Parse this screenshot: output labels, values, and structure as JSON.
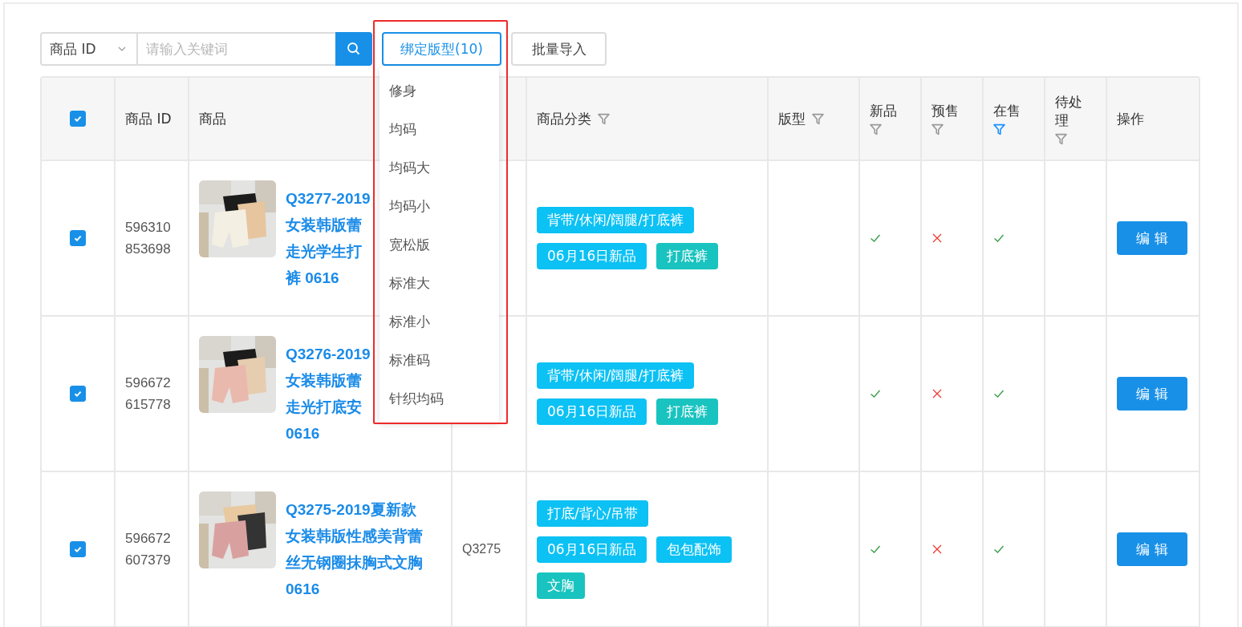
{
  "toolbar": {
    "search_type": "商品 ID",
    "search": {
      "placeholder": "请输入关键词"
    },
    "buttons": [
      {
        "label": "绑定版型(10)",
        "selected": true
      },
      {
        "label": "批量导入",
        "selected": false
      }
    ]
  },
  "dropdown": {
    "items": [
      "修身",
      "均码",
      "均码大",
      "均码小",
      "宽松版",
      "标准大",
      "标准小",
      "标准码",
      "针织均码"
    ]
  },
  "table": {
    "select_all": true,
    "columns": [
      {
        "label": "商品 ID"
      },
      {
        "label": "商品"
      },
      {},
      {
        "label": "商品分类",
        "filter": true,
        "filter_active": false
      },
      {
        "label": "版型",
        "filter": true,
        "filter_active": false
      },
      {
        "label": "新品",
        "filter": true,
        "filter_active": false
      },
      {
        "label": "预售",
        "filter": true,
        "filter_active": false
      },
      {
        "label": "在售",
        "filter": true,
        "filter_active": true
      },
      {
        "label": "待处理",
        "filter": true,
        "filter_active": false
      },
      {
        "label": "操作"
      }
    ],
    "rows": [
      {
        "selected": true,
        "id": "596310853698",
        "picture": {
          "kind": "picture"
        },
        "name_lines": [
          "Q3277-2019",
          "女装韩版蕾",
          "走光学生打",
          "裤 0616"
        ],
        "tags": [
          {
            "label": "背带/休闲/阔腿/打底裤",
            "color": "#0cc1f4"
          },
          {
            "label": "06月16日新品",
            "color": "#0cc1f4"
          },
          {
            "label": "打底裤",
            "color": "#19c3bf"
          }
        ],
        "new": true,
        "presale": false,
        "on_sale": true,
        "action": "编 辑"
      },
      {
        "selected": true,
        "id": "596672615778",
        "picture": {
          "kind": "picture"
        },
        "name_lines": [
          "Q3276-2019",
          "女装韩版蕾",
          "走光打底安",
          "0616"
        ],
        "tags": [
          {
            "label": "背带/休闲/阔腿/打底裤",
            "color": "#0cc1f4"
          },
          {
            "label": "06月16日新品",
            "color": "#0cc1f4"
          },
          {
            "label": "打底裤",
            "color": "#19c3bf"
          }
        ],
        "new": true,
        "presale": false,
        "on_sale": true,
        "action": "编 辑"
      },
      {
        "selected": true,
        "id": "596672607379",
        "picture": {
          "kind": "picture"
        },
        "name_lines": [
          "Q3275-2019夏新款",
          "女装韩版性感美背蕾",
          "丝无钢圈抹胸式文胸",
          "0616"
        ],
        "code": "Q3275",
        "tags": [
          {
            "label": "打底/背心/吊带",
            "color": "#0cc1f4"
          },
          {
            "label": "06月16日新品",
            "color": "#0cc1f4"
          },
          {
            "label": "包包配饰",
            "color": "#0cc1f4"
          },
          {
            "label": "文胸",
            "color": "#19c3bf"
          }
        ],
        "new": true,
        "presale": false,
        "on_sale": true,
        "action": "编 辑"
      }
    ]
  }
}
